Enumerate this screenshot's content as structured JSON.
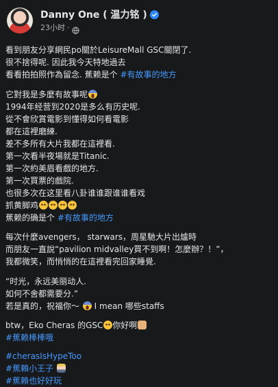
{
  "post": {
    "author": "Danny One ( 温力铭 )",
    "time": "23小时",
    "dot": "·",
    "lines_p1": [
      "看到朋友分享網民po關於LeisureMall GSC關閉了.",
      "很不捨得呢. 因此我今天特地過去",
      "看看拍拍照作為留念. 蕉赖是个"
    ],
    "p1_tag": "#有故事的地方",
    "p2_first": "它對我是多麼有故事呢",
    "lines_p2": [
      "1994年经营到2020是多么有历史呢.",
      "從不會欣賞電影到懂得如何看電影",
      "都在這裡磨練.",
      "差不多所有大片我都在這裡看.",
      "第一次看半夜場就是Titanic.",
      "第一次約美眉看戲的地方.",
      "第一次買票的戲院.",
      "也很多次在这里看八卦谁谁跟谁谁看戏"
    ],
    "p2_grab": "抓黄脚鸡",
    "p2_last": "蕉赖的确是个",
    "p2_tag": "#有故事的地方",
    "lines_p3": [
      "每次什麼avengers， starwars，周星馳大片出爐時",
      "而朋友一直說“pavilion midvalley買不到啊！怎麼辦？！”，",
      "我都微笑，而悄悄的在這裡看完回家睡覺."
    ],
    "lines_p4": [
      "“时光，永远美丽动人.",
      "如何不舍都需要分.”"
    ],
    "p4_last_a": "若是真的，祝福你～",
    "p4_last_b": "I mean 哪些staffs",
    "p5_a": "btw，Eko Cheras 的GSC",
    "p5_b": "你好啊",
    "p5_tag": "#蕉赖棒棒哦",
    "tags": [
      "#cherasIsHypeToo",
      "#蕉賴小王子",
      "#蕉賴也好好玩"
    ],
    "colors": {
      "background": "#18191a",
      "text": "#e4e6eb",
      "secondary": "#b0b3b8",
      "link": "#4599ff",
      "verified": "#2d88ff"
    }
  }
}
